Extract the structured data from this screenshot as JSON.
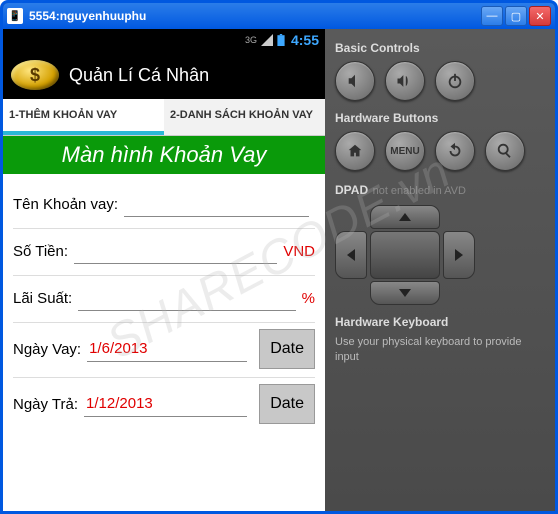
{
  "window": {
    "title": "5554:nguyenhuuphu"
  },
  "statusbar": {
    "net": "3G",
    "time": "4:55"
  },
  "appbar": {
    "coin": "$",
    "title": "Quản Lí Cá Nhân"
  },
  "tabs": {
    "t1": "1-THÊM KHOẢN VAY",
    "t2": "2-DANH SÁCH KHOẢN VAY"
  },
  "screen_title": "Màn hình Khoản Vay",
  "form": {
    "name_label": "Tên Khoản vay:",
    "amount_label": "Số Tiền:",
    "amount_unit": "VND",
    "rate_label": "Lãi Suất:",
    "rate_unit": "%",
    "borrow_label": "Ngày Vay:",
    "borrow_value": "1/6/2013",
    "pay_label": "Ngày Trả:",
    "pay_value": "1/12/2013",
    "date_btn": "Date"
  },
  "side": {
    "basic": "Basic Controls",
    "hardware": "Hardware Buttons",
    "menu": "MENU",
    "dpad_title": "DPAD",
    "dpad_msg": "not enabled in AVD",
    "kb_title": "Hardware Keyboard",
    "kb_msg": "Use your physical keyboard to provide input"
  },
  "watermark": "SHARECODE.vn"
}
